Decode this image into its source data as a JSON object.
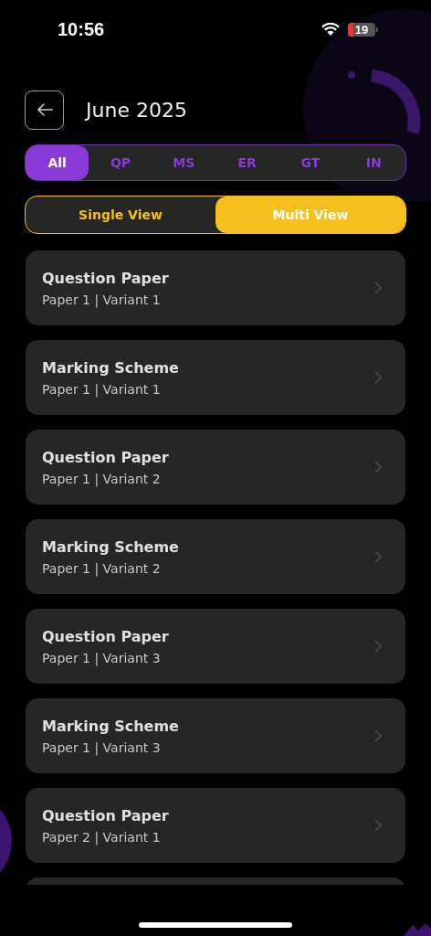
{
  "status_bar": {
    "time": "10:56",
    "battery": "19"
  },
  "header": {
    "title": "June 2025"
  },
  "filter_tabs": [
    {
      "label": "All",
      "selected": true
    },
    {
      "label": "QP",
      "selected": false
    },
    {
      "label": "MS",
      "selected": false
    },
    {
      "label": "ER",
      "selected": false
    },
    {
      "label": "GT",
      "selected": false
    },
    {
      "label": "IN",
      "selected": false
    }
  ],
  "view_toggle": [
    {
      "label": "Single View",
      "selected": false
    },
    {
      "label": "Multi View",
      "selected": true
    }
  ],
  "items": [
    {
      "title": "Question Paper",
      "subtitle": "Paper 1 | Variant 1"
    },
    {
      "title": "Marking Scheme",
      "subtitle": "Paper 1 | Variant 1"
    },
    {
      "title": "Question Paper",
      "subtitle": "Paper 1 | Variant 2"
    },
    {
      "title": "Marking Scheme",
      "subtitle": "Paper 1 | Variant 2"
    },
    {
      "title": "Question Paper",
      "subtitle": "Paper 1 | Variant 3"
    },
    {
      "title": "Marking Scheme",
      "subtitle": "Paper 1 | Variant 3"
    },
    {
      "title": "Question Paper",
      "subtitle": "Paper 2 | Variant 1"
    }
  ]
}
